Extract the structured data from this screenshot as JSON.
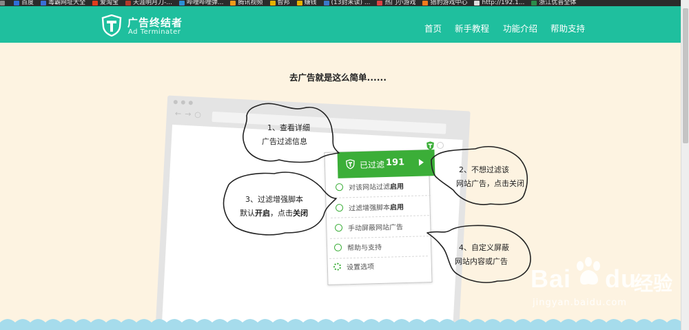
{
  "bookmarks": [
    {
      "label": "百度",
      "color": "#2f6ed8"
    },
    {
      "label": "毒霸网址大全",
      "color": "#3a6fd6"
    },
    {
      "label": "爱淘宝",
      "color": "#e23c1d"
    },
    {
      "label": "天涯明月刀-...",
      "color": "#b33a2b"
    },
    {
      "label": "哔哩哔哩弹...",
      "color": "#2d8fd5"
    },
    {
      "label": "腾讯视频",
      "color": "#f09a1b"
    },
    {
      "label": "智邦",
      "color": "#e7b100"
    },
    {
      "label": "赚钱",
      "color": "#e7b100"
    },
    {
      "label": "(13封未读) ...",
      "color": "#3a78c9"
    },
    {
      "label": "热门小游戏",
      "color": "#d44"
    },
    {
      "label": "猎豹游戏中心",
      "color": "#f27b1d"
    },
    {
      "label": "http://192.1...",
      "color": "#dddddd"
    },
    {
      "label": "浙江优普全体",
      "color": "#2c8b4a"
    }
  ],
  "header": {
    "brand_cn": "广告终结者",
    "brand_en": "Ad Terminater",
    "nav": [
      "首页",
      "新手教程",
      "功能介绍",
      "帮助支持"
    ],
    "bg_color": "#1fbf9e"
  },
  "main": {
    "title": "去广告就是这么简单......"
  },
  "popup": {
    "filtered_label": "已过滤",
    "filtered_count": "191",
    "items": [
      {
        "text": "对该网站过滤",
        "bold": "启用",
        "icon": "check-circle-icon"
      },
      {
        "text": "过滤增强脚本",
        "bold": "启用",
        "icon": "play-circle-icon"
      },
      {
        "text": "手动屏蔽网站广告",
        "bold": "",
        "icon": "eye-icon"
      },
      {
        "text": "帮助与支持",
        "bold": "",
        "icon": "question-icon"
      },
      {
        "text": "设置选项",
        "bold": "",
        "icon": "gear-icon"
      }
    ],
    "accent_color": "#3bae38"
  },
  "callouts": [
    {
      "line1": "1、查看详细",
      "line2": "广告过滤信息"
    },
    {
      "line1": "2、不想过滤该",
      "line2": "网站广告，点击关闭"
    },
    {
      "line1": "3、过滤增强脚本",
      "line2a": "默认",
      "line2b": "开启",
      "line2c": "，点击",
      "line2d": "关闭"
    },
    {
      "line1": "4、自定义屏蔽",
      "line2": "网站内容或广告"
    }
  ],
  "watermark": {
    "brand": "Bai",
    "brand_end": "du",
    "cn": "经验",
    "url": "jingyan.baidu.com"
  }
}
